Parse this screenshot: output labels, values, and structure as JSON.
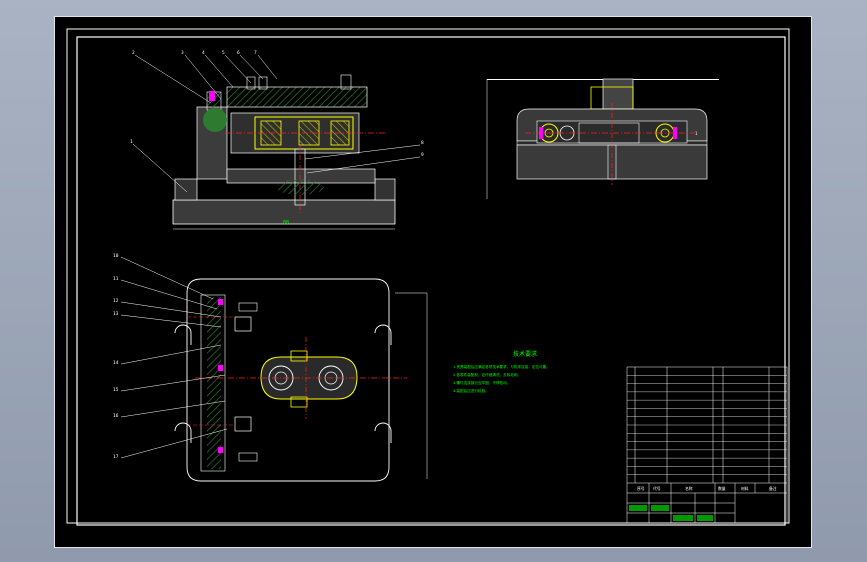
{
  "drawing": {
    "view_labels": {
      "top_balloon": "",
      "bottom_centre": ""
    },
    "balloons_front": [
      "2",
      "3",
      "4",
      "5",
      "6",
      "7",
      "1",
      "8",
      "9"
    ],
    "balloons_plan": [
      "10",
      "11",
      "12",
      "13",
      "14",
      "15",
      "16",
      "17"
    ],
    "tech_title": "技术要求",
    "tech_lines": [
      "1.夹具装配后应满足各项技术要求，与机床连接，定位可靠。",
      "2.各零件装配前，应仔细清洗，去除毛刺。",
      "3.螺钉连接部分应牢固，不得松动。",
      "4.装配后应进行检验。"
    ],
    "title_block": {
      "bom_rows": 14,
      "header": [
        "序号",
        "代号",
        "名称",
        "数量",
        "材料",
        "备注"
      ]
    }
  },
  "colors": {
    "line": "#ffffff",
    "yellow": "#ffff00",
    "red": "#ff2020",
    "green": "#00ff00",
    "magenta": "#ff00ff",
    "hatch_green": "#3a7a3a"
  }
}
